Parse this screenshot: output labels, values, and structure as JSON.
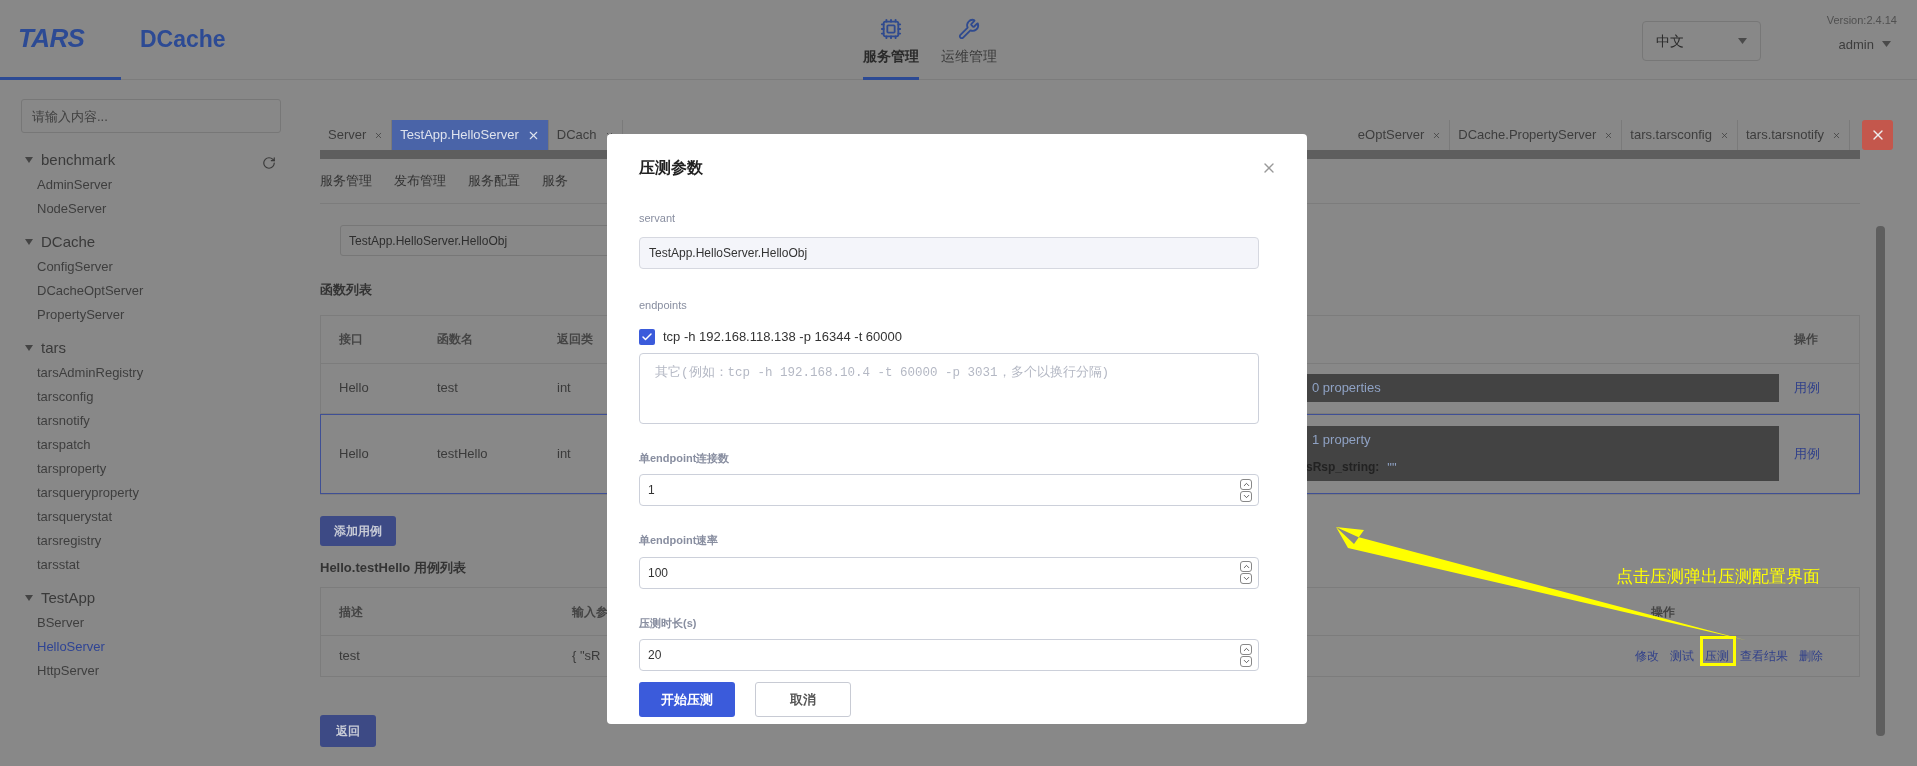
{
  "header": {
    "logos": [
      "TARS",
      "DCache"
    ],
    "nav": [
      {
        "label": "服务管理",
        "kind": "chip",
        "selected": true
      },
      {
        "label": "运维管理",
        "kind": "tools",
        "selected": false
      }
    ],
    "language": "中文",
    "version": "Version:2.4.14",
    "user": "admin"
  },
  "sidebar": {
    "search_placeholder": "请输入内容...",
    "tree": [
      {
        "label": "benchmark",
        "expanded": true,
        "children": [
          {
            "label": "AdminServer",
            "selected": false
          },
          {
            "label": "NodeServer",
            "selected": false
          }
        ]
      },
      {
        "label": "DCache",
        "expanded": true,
        "children": [
          {
            "label": "ConfigServer",
            "selected": false
          },
          {
            "label": "DCacheOptServer",
            "selected": false
          },
          {
            "label": "PropertyServer",
            "selected": false
          }
        ]
      },
      {
        "label": "tars",
        "expanded": true,
        "children": [
          {
            "label": "tarsAdminRegistry",
            "selected": false
          },
          {
            "label": "tarsconfig",
            "selected": false
          },
          {
            "label": "tarsnotify",
            "selected": false
          },
          {
            "label": "tarspatch",
            "selected": false
          },
          {
            "label": "tarsproperty",
            "selected": false
          },
          {
            "label": "tarsqueryproperty",
            "selected": false
          },
          {
            "label": "tarsquerystat",
            "selected": false
          },
          {
            "label": "tarsregistry",
            "selected": false
          },
          {
            "label": "tarsstat",
            "selected": false
          }
        ]
      },
      {
        "label": "TestApp",
        "expanded": true,
        "children": [
          {
            "label": "BServer",
            "selected": false
          },
          {
            "label": "HelloServer",
            "selected": true
          },
          {
            "label": "HttpServer",
            "selected": false
          }
        ]
      }
    ]
  },
  "tabs_left": [
    {
      "label": "Server",
      "selected": false
    },
    {
      "label": "TestApp.HelloServer",
      "selected": true
    },
    {
      "label": "DCach",
      "selected": false
    }
  ],
  "tabs_right": [
    {
      "label": "eOptServer",
      "selected": false
    },
    {
      "label": "DCache.PropertyServer",
      "selected": false
    },
    {
      "label": "tars.tarsconfig",
      "selected": false
    },
    {
      "label": "tars.tarsnotify",
      "selected": false
    }
  ],
  "sub_nav": [
    "服务管理",
    "发布管理",
    "服务配置",
    "服务"
  ],
  "servant_select": "TestApp.HelloServer.HelloObj",
  "functions": {
    "title": "函数列表",
    "columns": [
      "接口",
      "函数名",
      "返回类"
    ],
    "action_column": "操作",
    "rows": [
      {
        "cells": [
          "Hello",
          "test",
          "int"
        ],
        "selected": false,
        "summary": "0 properties",
        "fields": [],
        "action": "用例"
      },
      {
        "cells": [
          "Hello",
          "testHello",
          "int"
        ],
        "selected": true,
        "summary": "1 property",
        "fields": [
          {
            "key": "sRsp_string:",
            "value": "\"\""
          }
        ],
        "action": "用例"
      }
    ]
  },
  "add_button": "添加用例",
  "cases": {
    "title": "Hello.testHello 用例列表",
    "columns": [
      "描述",
      "输入参"
    ],
    "action_column": "操作",
    "rows": [
      {
        "cells": [
          "test",
          "{ \"sR"
        ],
        "actions": [
          "修改",
          "测试",
          "压测",
          "查看结果",
          "删除"
        ]
      }
    ]
  },
  "back_button": "返回",
  "annotation": {
    "text": "点击压测弹出压测配置界面"
  },
  "dialog": {
    "title": "压测参数",
    "servant": {
      "label": "servant",
      "value": "TestApp.HelloServer.HelloObj"
    },
    "endpoints": {
      "label": "endpoints",
      "items": [
        {
          "label": "tcp -h 192.168.118.138 -p 16344 -t 60000",
          "checked": true
        }
      ],
      "placeholder": "其它(例如：tcp -h 192.168.10.4 -t 60000 -p 3031，多个以换行分隔)"
    },
    "numbers": [
      {
        "label": "单endpoint连接数",
        "value": "1"
      },
      {
        "label": "单endpoint速率",
        "value": "100"
      },
      {
        "label": "压测时长(s)",
        "value": "20"
      }
    ],
    "confirm": "开始压测",
    "cancel": "取消"
  }
}
